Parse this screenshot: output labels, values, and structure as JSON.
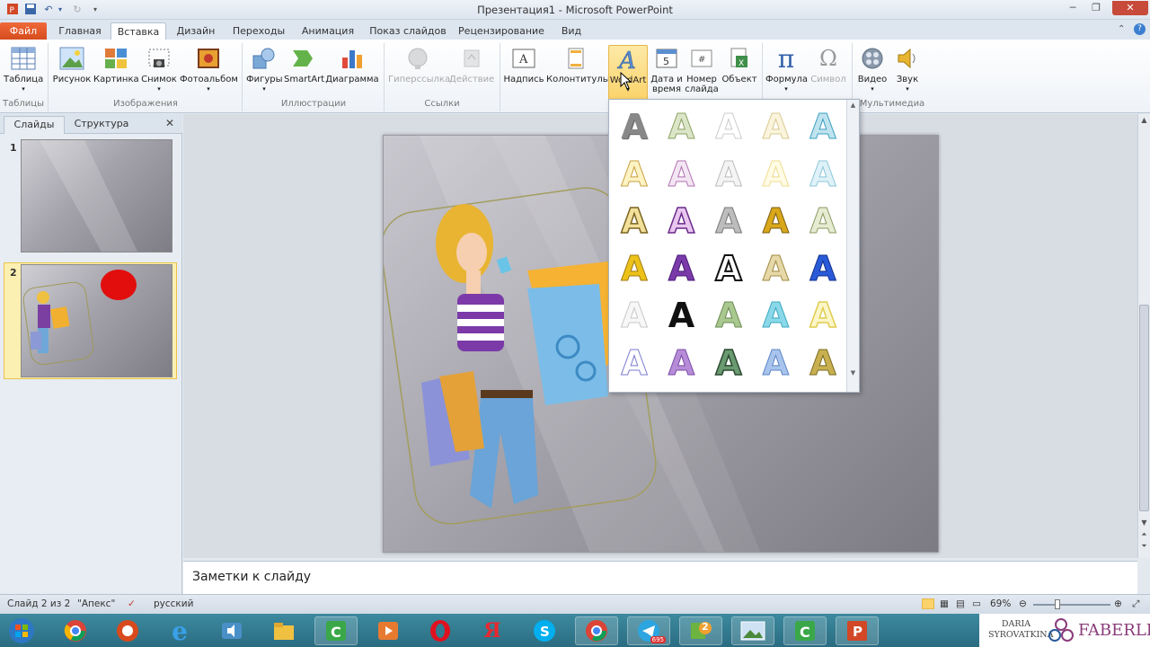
{
  "window": {
    "title": "Презентация1 - Microsoft PowerPoint"
  },
  "ribbon_tabs": [
    {
      "label": "Файл"
    },
    {
      "label": "Главная"
    },
    {
      "label": "Вставка"
    },
    {
      "label": "Дизайн"
    },
    {
      "label": "Переходы"
    },
    {
      "label": "Анимация"
    },
    {
      "label": "Показ слайдов"
    },
    {
      "label": "Рецензирование"
    },
    {
      "label": "Вид"
    }
  ],
  "ribbon": {
    "buttons": {
      "table": "Таблица",
      "picture": "Рисунок",
      "clipart": "Картинка",
      "screenshot": "Снимок",
      "photoalbum": "Фотоальбом",
      "shapes": "Фигуры",
      "smartart": "SmartArt",
      "chart": "Диаграмма",
      "hyperlink": "Гиперссылка",
      "action": "Действие",
      "textbox": "Надпись",
      "header_footer": "Колонтитулы",
      "wordart": "WordArt",
      "datetime_1": "Дата и",
      "datetime_2": "время",
      "slidenum_1": "Номер",
      "slidenum_2": "слайда",
      "object": "Объект",
      "equation": "Формула",
      "symbol": "Символ",
      "video": "Видео",
      "audio": "Звук"
    },
    "groups": {
      "tables": "Таблицы",
      "images": "Изображения",
      "illustrations": "Иллюстрации",
      "links": "Ссылки",
      "media": "Мультимедиа"
    }
  },
  "slides_panel": {
    "tab_slides": "Слайды",
    "tab_outline": "Структура",
    "slide_numbers": [
      "1",
      "2"
    ]
  },
  "notes": {
    "placeholder": "Заметки к слайду"
  },
  "status": {
    "slide_info": "Слайд 2 из 2",
    "theme": "\"Апекс\"",
    "language": "русский",
    "zoom": "69%"
  },
  "taskbar": {
    "telegram_badge": "695",
    "badge_2": "2"
  },
  "branding": {
    "name_1": "DARIA",
    "name_2": "SYROVATKINA",
    "logo": "FABERLIC"
  },
  "wordart_gallery": {
    "glyph": "A",
    "rows": 6,
    "cols": 5
  },
  "colors": {
    "file_tab": "#e05a2a",
    "accent_hover": "#fbd36a",
    "taskbar": "#2f7a8f"
  }
}
